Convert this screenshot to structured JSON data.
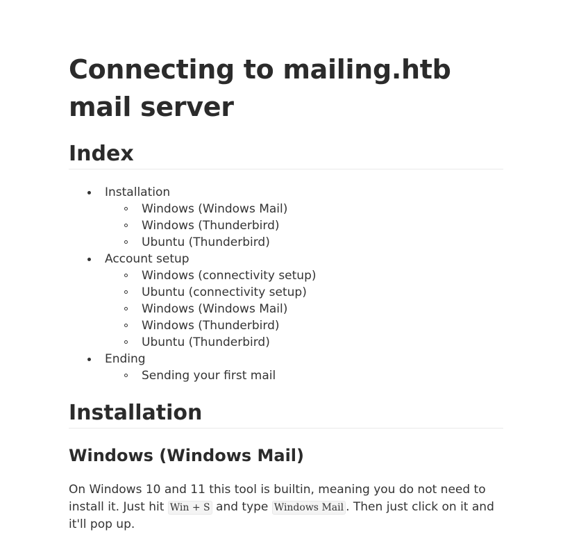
{
  "document": {
    "title": "Connecting to mailing.htb mail server",
    "index_heading": "Index",
    "toc": [
      {
        "label": "Installation",
        "children": [
          "Windows (Windows Mail)",
          "Windows (Thunderbird)",
          "Ubuntu (Thunderbird)"
        ]
      },
      {
        "label": "Account setup",
        "children": [
          "Windows (connectivity setup)",
          "Ubuntu (connectivity setup)",
          "Windows (Windows Mail)",
          "Windows (Thunderbird)",
          "Ubuntu (Thunderbird)"
        ]
      },
      {
        "label": "Ending",
        "children": [
          "Sending your first mail"
        ]
      }
    ],
    "installation_heading": "Installation",
    "windows_mail_heading": "Windows (Windows Mail)",
    "paragraph": {
      "part1": "On Windows 10 and 11 this tool is builtin, meaning you do not need to install it. Just hit ",
      "code1": "Win + S",
      "part2": " and type ",
      "code2": "Windows Mail",
      "part3": ". Then just click on it and it'll pop up."
    }
  }
}
